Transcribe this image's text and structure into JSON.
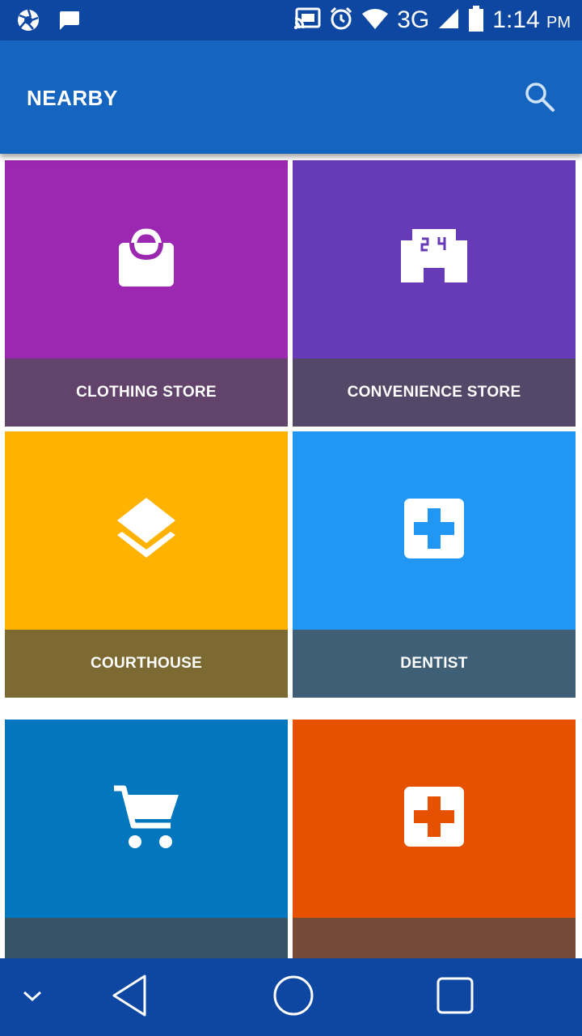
{
  "status_bar": {
    "network": "3G",
    "time": "1:14",
    "ampm": "PM",
    "icons": [
      "aperture-icon",
      "message-icon",
      "cast-icon",
      "alarm-icon",
      "wifi-icon",
      "signal-icon",
      "battery-icon"
    ]
  },
  "app_bar": {
    "title": "NEARBY",
    "search_icon": "search-icon"
  },
  "tiles": [
    {
      "label": "CLOTHING STORE",
      "icon": "shopping-bag-icon",
      "top_color": "#9c27b0",
      "bottom_color": "#62436b"
    },
    {
      "label": "CONVENIENCE STORE",
      "icon": "store-24-icon",
      "top_color": "#673ab7",
      "bottom_color": "#544869"
    },
    {
      "label": "COURTHOUSE",
      "icon": "layers-icon",
      "top_color": "#ffb300",
      "bottom_color": "#7d6a33"
    },
    {
      "label": "DENTIST",
      "icon": "medical-cross-icon",
      "top_color": "#2196f3",
      "bottom_color": "#3f5f77"
    },
    {
      "label": "",
      "icon": "shopping-cart-icon",
      "top_color": "#0277bd",
      "bottom_color": "#355567"
    },
    {
      "label": "",
      "icon": "hospital-icon",
      "top_color": "#e65100",
      "bottom_color": "#754a36"
    }
  ],
  "nav_bar": {
    "icons": [
      "chevron-down-icon",
      "back-icon",
      "home-icon",
      "recents-icon"
    ]
  }
}
